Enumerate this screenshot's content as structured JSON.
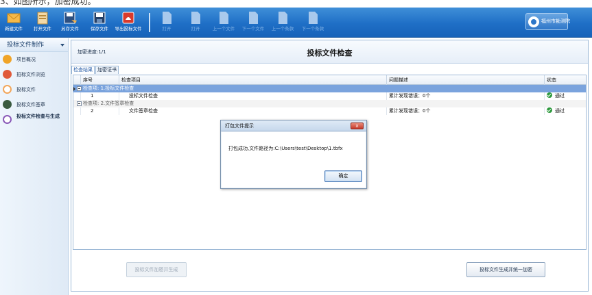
{
  "caption": "3、如图所示，加密成功。",
  "toolbar": {
    "buttons": [
      {
        "label": "新建文件",
        "icon": "mail-icon",
        "enabled": true
      },
      {
        "label": "打开文件",
        "icon": "open-file-icon",
        "enabled": true
      },
      {
        "label": "另存文件",
        "icon": "save-as-icon",
        "enabled": true
      },
      {
        "label": "保存文件",
        "icon": "save-icon",
        "enabled": true
      },
      {
        "label": "导出投标文件",
        "icon": "export-icon",
        "enabled": true
      },
      {
        "label": "打开",
        "icon": "document-icon",
        "enabled": false
      },
      {
        "label": "打开",
        "icon": "document-icon",
        "enabled": false
      },
      {
        "label": "上一个文件",
        "icon": "document-icon",
        "enabled": false
      },
      {
        "label": "下一个文件",
        "icon": "document-icon",
        "enabled": false
      },
      {
        "label": "上一个条款",
        "icon": "document-icon",
        "enabled": false
      },
      {
        "label": "下一个条款",
        "icon": "document-icon",
        "enabled": false
      }
    ],
    "brand": "福州市勘测院"
  },
  "sidebar": {
    "title": "投标文件制作",
    "items": [
      {
        "label": "项目概况",
        "icon": "project-icon",
        "color": "#f0a428"
      },
      {
        "label": "招标文件浏览",
        "icon": "browse-icon",
        "color": "#e05a3a"
      },
      {
        "label": "投标文件",
        "icon": "bid-file-icon",
        "color": "#f2a65a"
      },
      {
        "label": "投标文件签章",
        "icon": "signature-icon",
        "color": "#3a5a40"
      },
      {
        "label": "投标文件检查与生成",
        "icon": "check-icon",
        "color": "#8a5ab8",
        "active": true
      }
    ]
  },
  "main": {
    "progress": "加密进度:1/1",
    "title": "投标文件检查",
    "tabs": [
      "检查结果",
      "加密证书"
    ],
    "columns": [
      "序号",
      "检查项目",
      "问题描述",
      "状态"
    ],
    "groups": [
      {
        "label": "检查项: 1.投标文件检查",
        "selected": true,
        "rows": [
          {
            "no": "1",
            "item": "投标文件检查",
            "desc": "累计发现错误：0个",
            "status": "通过"
          }
        ]
      },
      {
        "label": "检查项: 2.文件签章检查",
        "selected": false,
        "rows": [
          {
            "no": "2",
            "item": "文件签章检查",
            "desc": "累计发现错误：0个",
            "status": "通过"
          }
        ]
      }
    ],
    "btn_encrypt": "投标文件加密并生成",
    "btn_generate": "投标文件生成并统一加密"
  },
  "dialog": {
    "title": "打包文件提示",
    "message": "打包成功,文件路径为:C:\\Users\\test\\Desktop\\1.tbfx",
    "ok": "确定",
    "close": "x"
  },
  "colors": {
    "toolbar": "#1f6fc6",
    "selected_row": "#7aa3dd",
    "pass": "#2e9a3e"
  }
}
